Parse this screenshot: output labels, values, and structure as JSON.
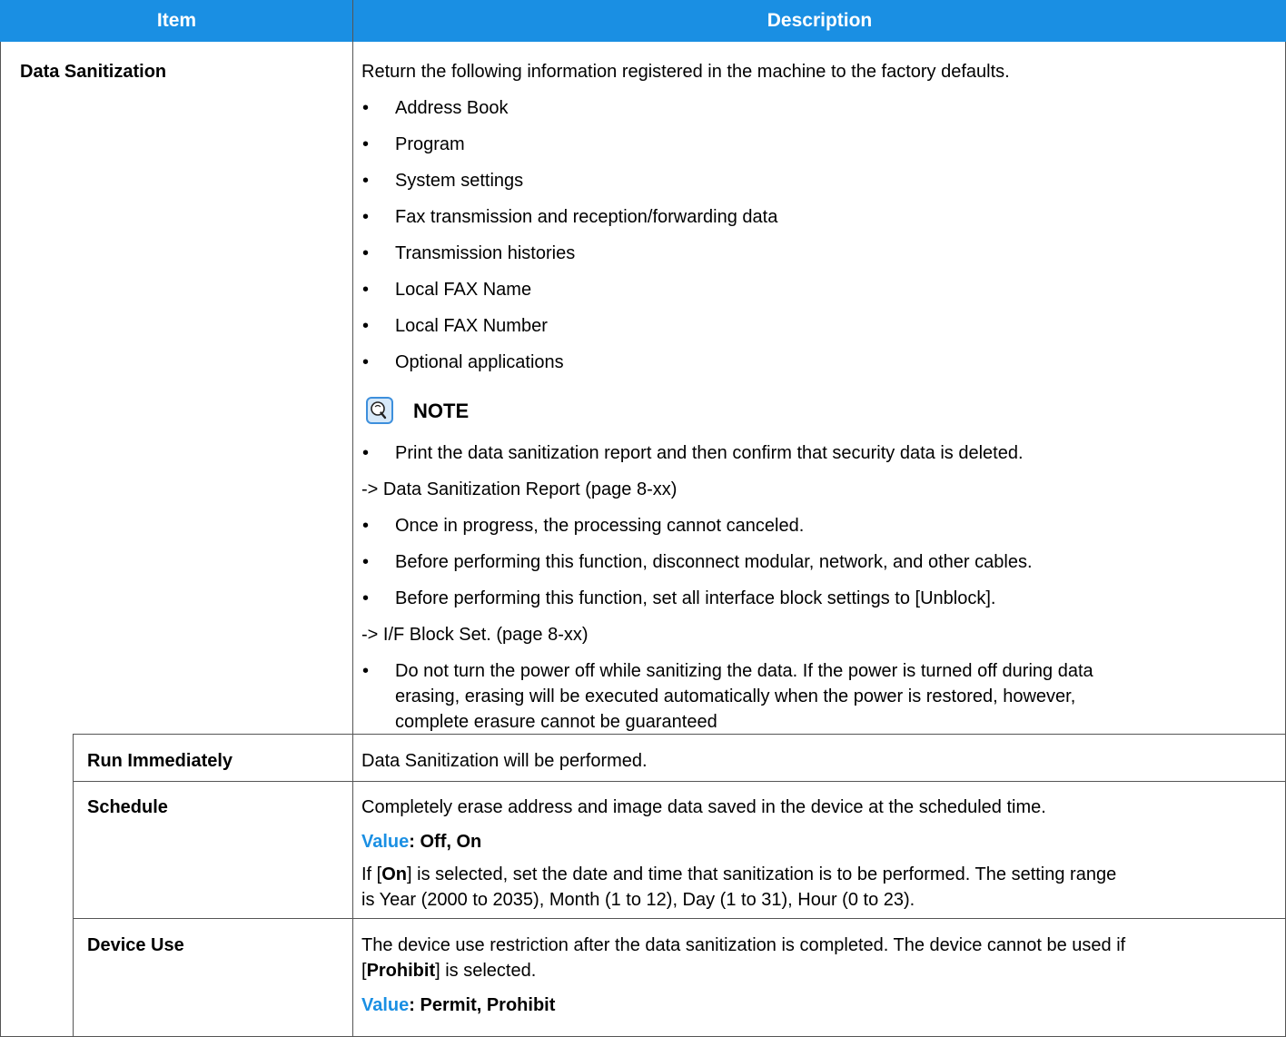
{
  "header": {
    "item": "Item",
    "description": "Description"
  },
  "data_sanitization": {
    "label": "Data Sanitization",
    "intro": "Return the following information registered in the machine to the factory defaults.",
    "items": [
      "Address Book",
      "Program",
      "System settings",
      "Fax transmission and reception/forwarding data",
      "Transmission histories",
      "Local FAX Name",
      "Local FAX Number",
      "Optional applications"
    ],
    "note_title": "NOTE",
    "note_1": "Print the data sanitization report and then confirm that security data is deleted.",
    "ref_1": "-> Data Sanitization Report (page 8-xx)",
    "note_2": "Once in progress, the processing cannot canceled.",
    "note_3": "Before performing this function, disconnect modular, network, and other cables.",
    "note_4": "Before performing this function, set all interface block settings to [Unblock].",
    "ref_2": "-> I/F Block Set. (page 8-xx)",
    "note_5_lines": [
      "Do not turn the power off while sanitizing the data. If the power is turned off during data",
      "erasing, erasing will be executed automatically when the power is restored, however,",
      "complete erasure cannot be guaranteed"
    ]
  },
  "run_immediately": {
    "label": "Run Immediately",
    "desc": "Data Sanitization will be performed."
  },
  "schedule": {
    "label": "Schedule",
    "desc": "Completely erase address and image data saved in the device at the scheduled time.",
    "value_label": "Value",
    "value_text": ": Off, On",
    "line2_pre": "If [",
    "line2_bold": "On",
    "line2_post": "] is selected, set the date and time that sanitization is to be performed. The setting range",
    "line3": "is Year (2000 to 2035), Month (1 to 12), Day (1 to 31), Hour (0 to 23)."
  },
  "device_use": {
    "label": "Device Use",
    "desc_1": "The device use restriction after the data sanitization is completed. The device cannot be used if",
    "desc_2_pre": "[",
    "desc_2_bold": "Prohibit",
    "desc_2_post": "] is selected.",
    "value_label": "Value",
    "value_text": ": Permit, Prohibit"
  },
  "colors": {
    "header_bg": "#1a8fe3",
    "value_label": "#1a8fe3"
  }
}
